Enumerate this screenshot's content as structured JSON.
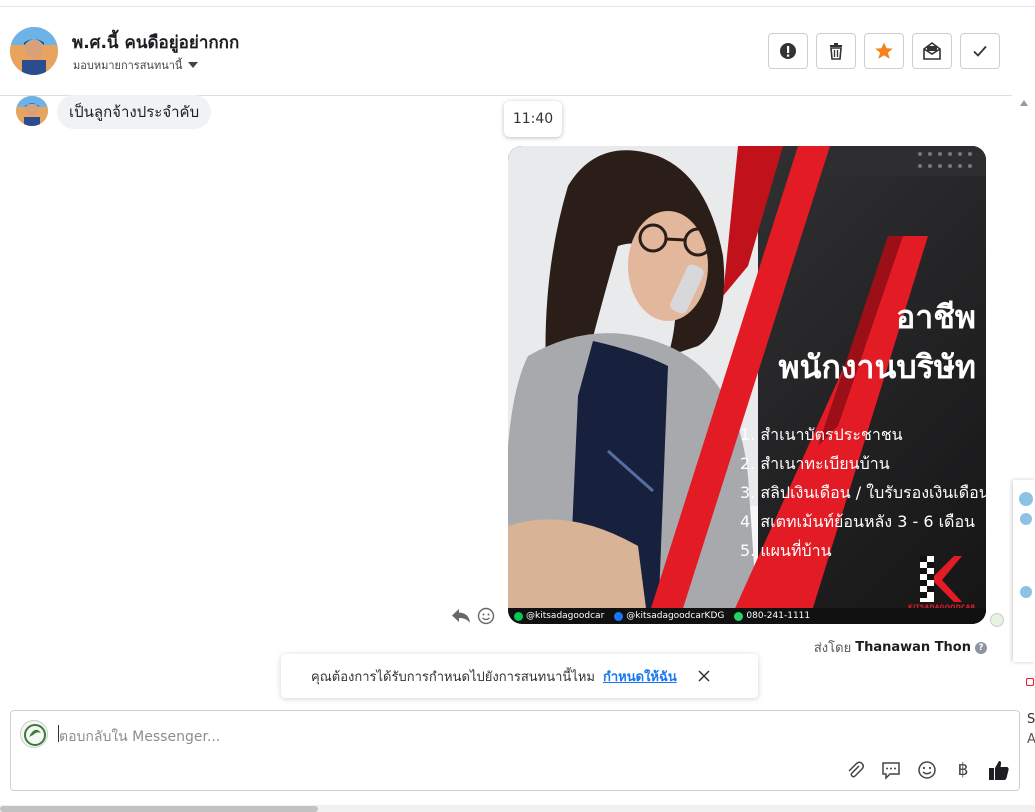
{
  "header": {
    "contact_name": "พ.ศ.นี้ คนดือยู่อย่ากกก",
    "assign_label": "มอบหมายการสนทนานี้",
    "actions": [
      {
        "name": "report-spam-button",
        "icon": "exclamation-circle-icon"
      },
      {
        "name": "delete-button",
        "icon": "trash-icon"
      },
      {
        "name": "star-button",
        "icon": "star-icon",
        "color": "#f5821f"
      },
      {
        "name": "mark-unread-button",
        "icon": "envelope-open-icon"
      },
      {
        "name": "mark-done-button",
        "icon": "check-icon"
      }
    ]
  },
  "messages": {
    "incoming_text": "เป็นลูกจ้างประจำคับ",
    "time_tooltip": "11:40",
    "ad_image": {
      "heading_1": "อาชีพ",
      "heading_2": "พนักงานบริษัท",
      "items": [
        "1. สำเนาบัตรประชาชน",
        "2. สำเนาทะเบียนบ้าน",
        "3. สลิปเงินเดือน / ใบรับรองเงินเดือน",
        "4. สเตทเม้นท์ย้อนหลัง 3 - 6 เดือน",
        "5. แผนที่บ้าน"
      ],
      "brand": "KITSADAGOODCAR",
      "footer_line": "@kitsadagoodcar",
      "footer_fb": "@kitsadagoodcarKDG",
      "footer_phone": "080-241-1111",
      "accent_color": "#e21b24"
    },
    "sent_by_prefix": "ส่งโดย",
    "sent_by_name": "Thanawan Thon"
  },
  "assign_banner": {
    "text": "คุณต้องการได้รับการกำหนดไปยังการสนทนานี้ไหม",
    "link": "กำหนดให้ฉัน"
  },
  "composer": {
    "placeholder": "ตอบกลับใน Messenger...",
    "currency_symbol": "฿",
    "tools": [
      "attach-icon",
      "saved-reply-icon",
      "emoji-icon",
      "payment-icon",
      "like-icon"
    ]
  },
  "right_panel": {
    "letter_1": "S",
    "letter_2": "A"
  }
}
